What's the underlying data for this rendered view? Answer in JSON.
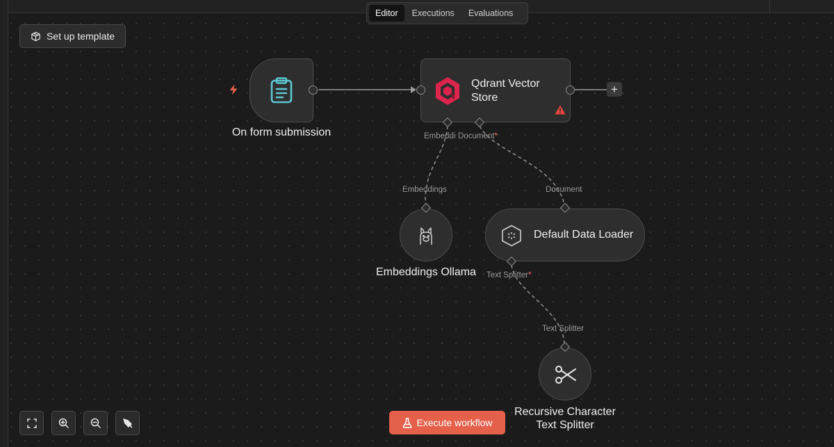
{
  "tabs": [
    {
      "label": "Editor",
      "active": true
    },
    {
      "label": "Executions",
      "active": false
    },
    {
      "label": "Evaluations",
      "active": false
    }
  ],
  "template_button": {
    "label": "Set up template",
    "icon": "box-icon"
  },
  "nodes": {
    "form": {
      "label": "On form submission",
      "icon": "clipboard-icon",
      "trigger_icon": "bolt-icon"
    },
    "qdrant": {
      "label_line1": "Qdrant Vector",
      "label_line2": "Store",
      "icon": "qdrant-logo-icon",
      "warning_icon": "warning-icon"
    },
    "embeddings": {
      "label": "Embeddings Ollama",
      "icon": "ollama-llama-icon"
    },
    "loader": {
      "label": "Default Data Loader",
      "icon": "data-loader-icon"
    },
    "splitter": {
      "label_line1": "Recursive Character",
      "label_line2": "Text Splitter",
      "icon": "scissors-icon"
    }
  },
  "connectors": {
    "qdrant_embedding": "Embeddi",
    "qdrant_document": "Document",
    "required_mark": "*",
    "embeddings_input": "Embeddings",
    "loader_document": "Document",
    "loader_text_splitter": "Text Splitter",
    "splitter_input": "Text Splitter"
  },
  "add_button": "+",
  "controls": [
    "fit-view-icon",
    "zoom-in-icon",
    "zoom-out-icon",
    "tidy-up-icon"
  ],
  "execute_button": {
    "label": "Execute workflow",
    "icon": "flask-icon"
  },
  "colors": {
    "accent": "#e5604a",
    "trigger": "#e5604a",
    "clipboard": "#5cc8d1",
    "qdrant": "#dc244c",
    "warning": "#e8473a"
  }
}
